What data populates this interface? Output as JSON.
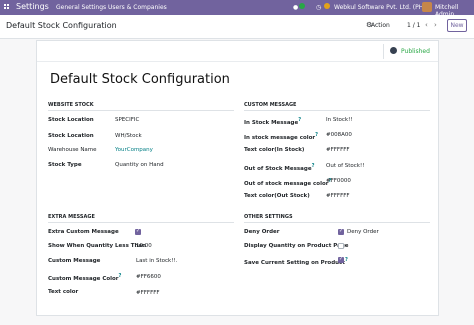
{
  "navbar": {
    "app_name": "Settings",
    "menu": [
      "General Settings",
      "Users & Companies"
    ],
    "chat_count": "6",
    "activity_count": "2",
    "company": "Webkul Software Pvt. Ltd. (PHD)",
    "user": "Mitchell Admin",
    "colors": {
      "bar": "#71639e"
    }
  },
  "control": {
    "breadcrumb": "Default Stock Configuration",
    "action_label": "Action",
    "pager": "1 / 1",
    "prev": "‹",
    "next": "›",
    "new_label": "New"
  },
  "status": {
    "published": "Published"
  },
  "form": {
    "title": "Default Stock Configuration",
    "website_stock": {
      "heading": "WEBSITE STOCK",
      "fields": [
        {
          "label": "Stock Location",
          "value": "SPECIFIC"
        },
        {
          "label": "Stock Location",
          "value": "WH/Stock"
        },
        {
          "label": "Warehouse Name",
          "value": "YourCompany"
        },
        {
          "label": "Stock Type",
          "value": "Quantity on Hand"
        }
      ]
    },
    "custom_message": {
      "heading": "CUSTOM MESSAGE",
      "fields": [
        {
          "label": "In Stock Message",
          "value": "In Stock!!"
        },
        {
          "label": "In stock message color",
          "value": "#008A00"
        },
        {
          "label": "Text color(In Stock)",
          "value": "#FFFFFF"
        },
        {
          "label": "Out of Stock Message",
          "value": "Out of Stock!!"
        },
        {
          "label": "Out of stock message color",
          "value": "#FF0000"
        },
        {
          "label": "Text color(Out Stock)",
          "value": "#FFFFFF"
        }
      ]
    },
    "extra_message": {
      "heading": "EXTRA MESSAGE",
      "fields": [
        {
          "label": "Extra Custom Message",
          "value": ""
        },
        {
          "label": "Show When Quantity Less Than",
          "value": "10.00"
        },
        {
          "label": "Custom Message",
          "value": "Last in Stock!!."
        },
        {
          "label": "Custom Message Color",
          "value": "#FF6600"
        },
        {
          "label": "Text color",
          "value": "#FFFFFF"
        }
      ],
      "extra_checked": true
    },
    "other_settings": {
      "heading": "OTHER SETTINGS",
      "fields": [
        {
          "label": "Deny Order",
          "value": "Deny Order",
          "checked": true
        },
        {
          "label": "Display Quantity on Product Page",
          "value": "",
          "checked": false
        },
        {
          "label": "Save Current Setting on Product",
          "value": "",
          "checked": true
        }
      ]
    },
    "help_mark": "?"
  }
}
